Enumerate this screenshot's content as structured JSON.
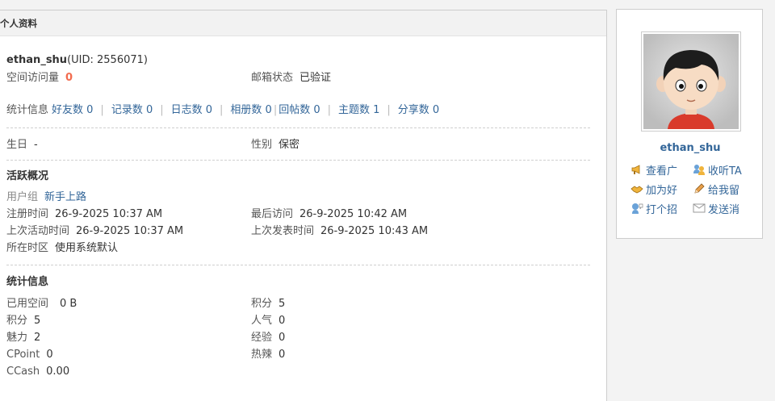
{
  "header": {
    "title": "个人资料"
  },
  "profile": {
    "username": "ethan_shu",
    "uid_text": "(UID: 2556071)",
    "visits_label": "空间访问量",
    "visits_value": "0",
    "email_label": "邮箱状态",
    "email_value": "已验证"
  },
  "stats_line": {
    "label": "统计信息",
    "items": [
      {
        "label": "好友数 0"
      },
      {
        "label": "记录数 0"
      },
      {
        "label": "日志数 0"
      },
      {
        "label": "相册数 0"
      },
      {
        "label": "回帖数 0"
      },
      {
        "label": "主题数 1"
      },
      {
        "label": "分享数 0"
      }
    ]
  },
  "personal": {
    "birthday_label": "生日",
    "birthday_value": "-",
    "gender_label": "性别",
    "gender_value": "保密"
  },
  "activity": {
    "title": "活跃概况",
    "group_label": "用户组",
    "group_value": "新手上路",
    "register_label": "注册时间",
    "register_value": "26-9-2025 10:37 AM",
    "last_visit_label": "最后访问",
    "last_visit_value": "26-9-2025 10:42 AM",
    "last_active_label": "上次活动时间",
    "last_active_value": "26-9-2025 10:37 AM",
    "last_post_label": "上次发表时间",
    "last_post_value": "26-9-2025 10:43 AM",
    "timezone_label": "所在时区",
    "timezone_value": "使用系统默认"
  },
  "statistics": {
    "title": "统计信息",
    "space_label": "已用空间",
    "space_value": "0 B",
    "credits_label": "积分",
    "credits_value": "5",
    "credits2_label": "积分",
    "credits2_value": "5",
    "popularity_label": "人气",
    "popularity_value": "0",
    "charm_label": "魅力",
    "charm_value": "2",
    "experience_label": "经验",
    "experience_value": "0",
    "cpoint_label": "CPoint",
    "cpoint_value": "0",
    "hot_label": "热辣",
    "hot_value": "0",
    "ccash_label": "CCash",
    "ccash_value": "0.00"
  },
  "sidebar": {
    "username": "ethan_shu",
    "actions": [
      {
        "label": "查看广",
        "icon": "megaphone-icon"
      },
      {
        "label": "收听TA",
        "icon": "follow-users-icon"
      },
      {
        "label": "加为好",
        "icon": "handshake-icon"
      },
      {
        "label": "给我留",
        "icon": "pencil-icon"
      },
      {
        "label": "打个招",
        "icon": "greet-icon"
      },
      {
        "label": "发送消",
        "icon": "envelope-icon"
      }
    ]
  },
  "colors": {
    "link": "#336699",
    "zero_value": "#f26c4f",
    "header_bg": "#f2f2f2"
  }
}
